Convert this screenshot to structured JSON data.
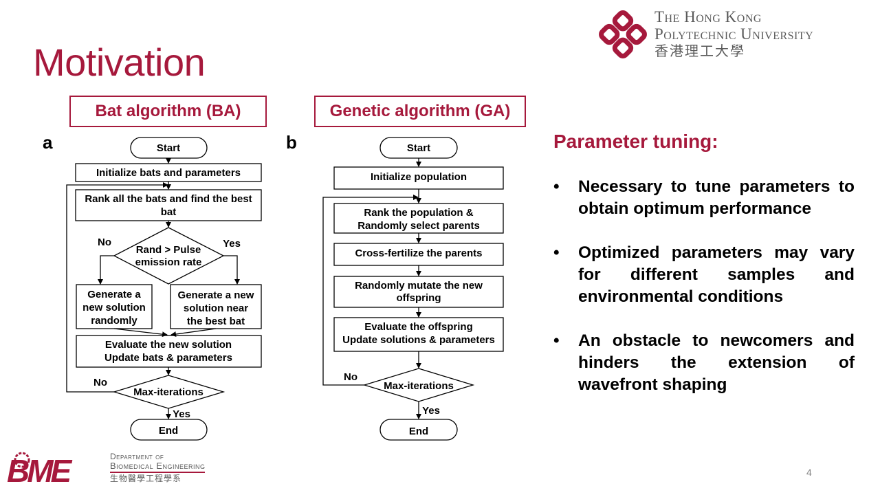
{
  "slide": {
    "title": "Motivation",
    "page_number": "4"
  },
  "logo_polyu": {
    "line1": "The Hong Kong",
    "line2": "Polytechnic University",
    "line3": "香港理工大學"
  },
  "logo_bme": {
    "dept_line1": "Department of",
    "dept_line2": "Biomedical Engineering",
    "dept_line3": "生物醫學工程學系",
    "mark": "BME"
  },
  "panels": {
    "ba": {
      "header": "Bat algorithm (BA)",
      "letter": "a",
      "start": "Start",
      "init": "Initialize bats and parameters",
      "rank_line1": "Rank all the bats and find the best",
      "rank_line2": "bat",
      "decision_line1": "Rand > Pulse",
      "decision_line2": "emission rate",
      "no": "No",
      "yes": "Yes",
      "gen_random_line1": "Generate a",
      "gen_random_line2": "new solution",
      "gen_random_line3": "randomly",
      "gen_best_line1": "Generate a new",
      "gen_best_line2": "solution near",
      "gen_best_line3": "the best bat",
      "eval_line1": "Evaluate the new solution",
      "eval_line2": "Update bats & parameters",
      "max_iter": "Max-iterations",
      "loop_no": "No",
      "end_yes": "Yes",
      "end": "End"
    },
    "ga": {
      "header": "Genetic algorithm (GA)",
      "letter": "b",
      "start": "Start",
      "init": "Initialize population",
      "rank_line1": "Rank the population &",
      "rank_line2": "Randomly select parents",
      "cross": "Cross-fertilize the parents",
      "mutate_line1": "Randomly mutate the new",
      "mutate_line2": "offspring",
      "eval_line1": "Evaluate the offspring",
      "eval_line2": "Update solutions & parameters",
      "max_iter": "Max-iterations",
      "loop_no": "No",
      "end_yes": "Yes",
      "end": "End"
    }
  },
  "tuning": {
    "title": "Parameter tuning:",
    "bullet_symbol": "•",
    "bullets": [
      "Necessary to tune parameters to obtain optimum performance",
      "Optimized parameters may vary for different samples and environmental conditions",
      "An obstacle to newcomers and hinders the extension of wavefront shaping"
    ]
  },
  "colors": {
    "accent": "#a6193c",
    "text": "#000000",
    "logo_gray": "#5a5a5a"
  }
}
